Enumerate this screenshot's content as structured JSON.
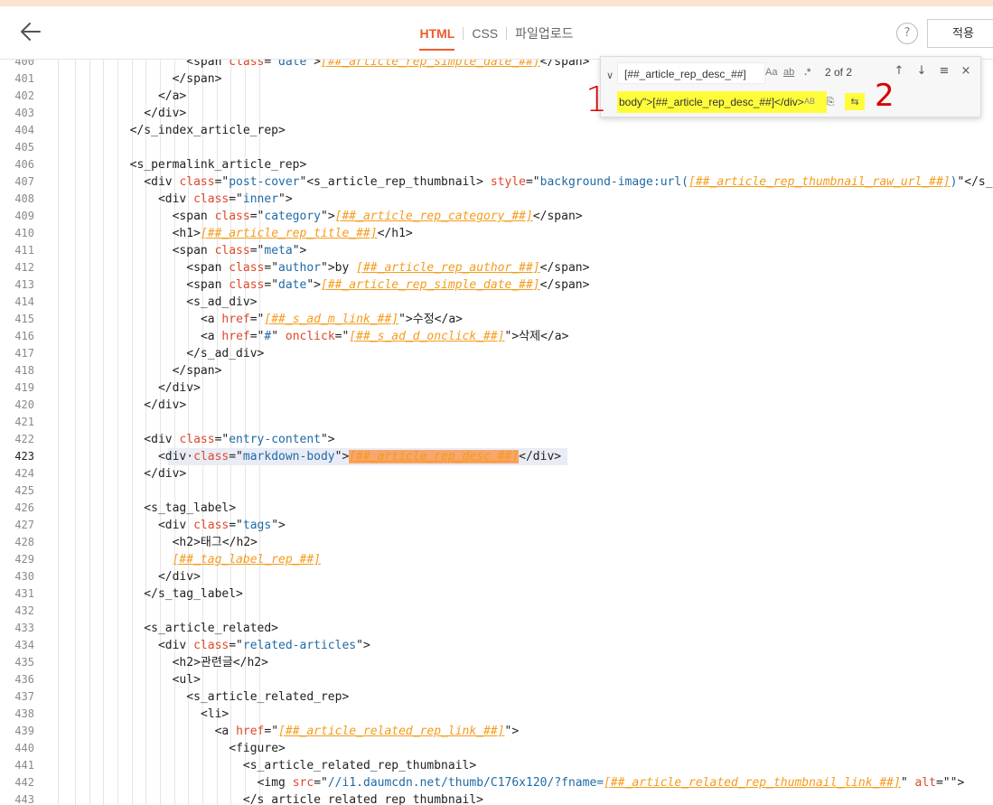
{
  "header": {
    "tabs": [
      {
        "label": "HTML",
        "active": true
      },
      {
        "label": "CSS",
        "active": false
      },
      {
        "label": "파일업로드",
        "active": false
      }
    ],
    "help_label": "?",
    "apply_label": "적용"
  },
  "find_widget": {
    "search_value": "[##_article_rep_desc_##]",
    "opt_case": "Aa",
    "opt_word": "ab",
    "opt_regex": ".*",
    "match_count": "2 of 2",
    "replace_value": "body\">[##_article_rep_desc_##]</div>",
    "preserve_case": "AB",
    "annotation_1": "1",
    "annotation_2": "2",
    "icons": [
      "chevron-icon",
      "arrow-up-icon",
      "arrow-down-icon",
      "selection-icon",
      "close-icon",
      "replace-icon",
      "replace-all-icon"
    ]
  },
  "colors": {
    "accent": "#ef5b2f",
    "tag": "#222222",
    "attribute": "#e0482a",
    "string": "#1f6aa5",
    "variable": "#f59b1c",
    "highlight": "#fffd3a",
    "annotation": "#d80000"
  },
  "editor": {
    "current_line": 423,
    "lines": [
      {
        "n": "400",
        "indent": 9,
        "tokens": [
          [
            "t",
            "<span "
          ],
          [
            "a",
            "class"
          ],
          [
            "t",
            "=\""
          ],
          [
            "s",
            "date"
          ],
          [
            "t",
            "\">"
          ],
          [
            "v",
            "[##_article_rep_simple_date_##]"
          ],
          [
            "t",
            "</span>"
          ]
        ]
      },
      {
        "n": "401",
        "indent": 8,
        "tokens": [
          [
            "t",
            "</span>"
          ]
        ]
      },
      {
        "n": "402",
        "indent": 7,
        "tokens": [
          [
            "t",
            "</a>"
          ]
        ]
      },
      {
        "n": "403",
        "indent": 6,
        "tokens": [
          [
            "t",
            "</div>"
          ]
        ]
      },
      {
        "n": "404",
        "indent": 5,
        "tokens": [
          [
            "t",
            "</s_index_article_rep>"
          ]
        ]
      },
      {
        "n": "405",
        "indent": 0,
        "tokens": []
      },
      {
        "n": "406",
        "indent": 5,
        "tokens": [
          [
            "t",
            "<s_permalink_article_rep>"
          ]
        ]
      },
      {
        "n": "407",
        "indent": 6,
        "tokens": [
          [
            "t",
            "<div "
          ],
          [
            "a",
            "class"
          ],
          [
            "t",
            "=\""
          ],
          [
            "s",
            "post-cover"
          ],
          [
            "t",
            "\"<s_article_rep_thumbnail> "
          ],
          [
            "a",
            "style"
          ],
          [
            "t",
            "=\""
          ],
          [
            "s",
            "background-image:url("
          ],
          [
            "v",
            "[##_article_rep_thumbnail_raw_url_##]"
          ],
          [
            "s",
            ")"
          ],
          [
            "t",
            "\"</s_a"
          ]
        ]
      },
      {
        "n": "408",
        "indent": 7,
        "tokens": [
          [
            "t",
            "<div "
          ],
          [
            "a",
            "class"
          ],
          [
            "t",
            "=\""
          ],
          [
            "s",
            "inner"
          ],
          [
            "t",
            "\">"
          ]
        ]
      },
      {
        "n": "409",
        "indent": 8,
        "tokens": [
          [
            "t",
            "<span "
          ],
          [
            "a",
            "class"
          ],
          [
            "t",
            "=\""
          ],
          [
            "s",
            "category"
          ],
          [
            "t",
            "\">"
          ],
          [
            "v",
            "[##_article_rep_category_##]"
          ],
          [
            "t",
            "</span>"
          ]
        ]
      },
      {
        "n": "410",
        "indent": 8,
        "tokens": [
          [
            "t",
            "<h1>"
          ],
          [
            "v",
            "[##_article_rep_title_##]"
          ],
          [
            "t",
            "</h1>"
          ]
        ]
      },
      {
        "n": "411",
        "indent": 8,
        "tokens": [
          [
            "t",
            "<span "
          ],
          [
            "a",
            "class"
          ],
          [
            "t",
            "=\""
          ],
          [
            "s",
            "meta"
          ],
          [
            "t",
            "\">"
          ]
        ]
      },
      {
        "n": "412",
        "indent": 9,
        "tokens": [
          [
            "t",
            "<span "
          ],
          [
            "a",
            "class"
          ],
          [
            "t",
            "=\""
          ],
          [
            "s",
            "author"
          ],
          [
            "t",
            "\">by "
          ],
          [
            "v",
            "[##_article_rep_author_##]"
          ],
          [
            "t",
            "</span>"
          ]
        ]
      },
      {
        "n": "413",
        "indent": 9,
        "tokens": [
          [
            "t",
            "<span "
          ],
          [
            "a",
            "class"
          ],
          [
            "t",
            "=\""
          ],
          [
            "s",
            "date"
          ],
          [
            "t",
            "\">"
          ],
          [
            "v",
            "[##_article_rep_simple_date_##]"
          ],
          [
            "t",
            "</span>"
          ]
        ]
      },
      {
        "n": "414",
        "indent": 9,
        "tokens": [
          [
            "t",
            "<s_ad_div>"
          ]
        ]
      },
      {
        "n": "415",
        "indent": 10,
        "tokens": [
          [
            "t",
            "<a "
          ],
          [
            "a",
            "href"
          ],
          [
            "t",
            "=\""
          ],
          [
            "v",
            "[##_s_ad_m_link_##]"
          ],
          [
            "t",
            "\">수정</a>"
          ]
        ]
      },
      {
        "n": "416",
        "indent": 10,
        "tokens": [
          [
            "t",
            "<a "
          ],
          [
            "a",
            "href"
          ],
          [
            "t",
            "=\""
          ],
          [
            "s",
            "#"
          ],
          [
            "t",
            "\" "
          ],
          [
            "a",
            "onclick"
          ],
          [
            "t",
            "=\""
          ],
          [
            "v",
            "[##_s_ad_d_onclick_##]"
          ],
          [
            "t",
            "\">삭제</a>"
          ]
        ]
      },
      {
        "n": "417",
        "indent": 9,
        "tokens": [
          [
            "t",
            "</s_ad_div>"
          ]
        ]
      },
      {
        "n": "418",
        "indent": 8,
        "tokens": [
          [
            "t",
            "</span>"
          ]
        ]
      },
      {
        "n": "419",
        "indent": 7,
        "tokens": [
          [
            "t",
            "</div>"
          ]
        ]
      },
      {
        "n": "420",
        "indent": 6,
        "tokens": [
          [
            "t",
            "</div>"
          ]
        ]
      },
      {
        "n": "421",
        "indent": 0,
        "tokens": []
      },
      {
        "n": "422",
        "indent": 6,
        "tokens": [
          [
            "t",
            "<div "
          ],
          [
            "a",
            "class"
          ],
          [
            "t",
            "=\""
          ],
          [
            "s",
            "entry-content"
          ],
          [
            "t",
            "\">"
          ]
        ]
      },
      {
        "n": "423",
        "indent": 7,
        "highlight": true,
        "tokens": [
          [
            "t",
            "<div·"
          ],
          [
            "a",
            "class"
          ],
          [
            "t",
            "=\""
          ],
          [
            "s",
            "markdown-body"
          ],
          [
            "t",
            "\">"
          ],
          [
            "vm",
            "[##_article_rep_desc_##]"
          ],
          [
            "t",
            "</div>"
          ]
        ]
      },
      {
        "n": "424",
        "indent": 6,
        "tokens": [
          [
            "t",
            "</div>"
          ]
        ]
      },
      {
        "n": "425",
        "indent": 0,
        "tokens": []
      },
      {
        "n": "426",
        "indent": 6,
        "tokens": [
          [
            "t",
            "<s_tag_label>"
          ]
        ]
      },
      {
        "n": "427",
        "indent": 7,
        "tokens": [
          [
            "t",
            "<div "
          ],
          [
            "a",
            "class"
          ],
          [
            "t",
            "=\""
          ],
          [
            "s",
            "tags"
          ],
          [
            "t",
            "\">"
          ]
        ]
      },
      {
        "n": "428",
        "indent": 8,
        "tokens": [
          [
            "t",
            "<h2>태그</h2>"
          ]
        ]
      },
      {
        "n": "429",
        "indent": 8,
        "tokens": [
          [
            "v",
            "[##_tag_label_rep_##]"
          ]
        ]
      },
      {
        "n": "430",
        "indent": 7,
        "tokens": [
          [
            "t",
            "</div>"
          ]
        ]
      },
      {
        "n": "431",
        "indent": 6,
        "tokens": [
          [
            "t",
            "</s_tag_label>"
          ]
        ]
      },
      {
        "n": "432",
        "indent": 0,
        "tokens": []
      },
      {
        "n": "433",
        "indent": 6,
        "tokens": [
          [
            "t",
            "<s_article_related>"
          ]
        ]
      },
      {
        "n": "434",
        "indent": 7,
        "tokens": [
          [
            "t",
            "<div "
          ],
          [
            "a",
            "class"
          ],
          [
            "t",
            "=\""
          ],
          [
            "s",
            "related-articles"
          ],
          [
            "t",
            "\">"
          ]
        ]
      },
      {
        "n": "435",
        "indent": 8,
        "tokens": [
          [
            "t",
            "<h2>관련글</h2>"
          ]
        ]
      },
      {
        "n": "436",
        "indent": 8,
        "tokens": [
          [
            "t",
            "<ul>"
          ]
        ]
      },
      {
        "n": "437",
        "indent": 9,
        "tokens": [
          [
            "t",
            "<s_article_related_rep>"
          ]
        ]
      },
      {
        "n": "438",
        "indent": 10,
        "tokens": [
          [
            "t",
            "<li>"
          ]
        ]
      },
      {
        "n": "439",
        "indent": 11,
        "tokens": [
          [
            "t",
            "<a "
          ],
          [
            "a",
            "href"
          ],
          [
            "t",
            "=\""
          ],
          [
            "v",
            "[##_article_related_rep_link_##]"
          ],
          [
            "t",
            "\">"
          ]
        ]
      },
      {
        "n": "440",
        "indent": 12,
        "tokens": [
          [
            "t",
            "<figure>"
          ]
        ]
      },
      {
        "n": "441",
        "indent": 13,
        "tokens": [
          [
            "t",
            "<s_article_related_rep_thumbnail>"
          ]
        ]
      },
      {
        "n": "442",
        "indent": 14,
        "tokens": [
          [
            "t",
            "<img "
          ],
          [
            "a",
            "src"
          ],
          [
            "t",
            "=\""
          ],
          [
            "s",
            "//i1.daumcdn.net/thumb/C176x120/?fname="
          ],
          [
            "v",
            "[##_article_related_rep_thumbnail_link_##]"
          ],
          [
            "t",
            "\" "
          ],
          [
            "a",
            "alt"
          ],
          [
            "t",
            "=\""
          ],
          [
            "t",
            "\">"
          ]
        ]
      },
      {
        "n": "443",
        "indent": 13,
        "tokens": [
          [
            "t",
            "</s_article_related_rep_thumbnail>"
          ]
        ]
      }
    ]
  }
}
